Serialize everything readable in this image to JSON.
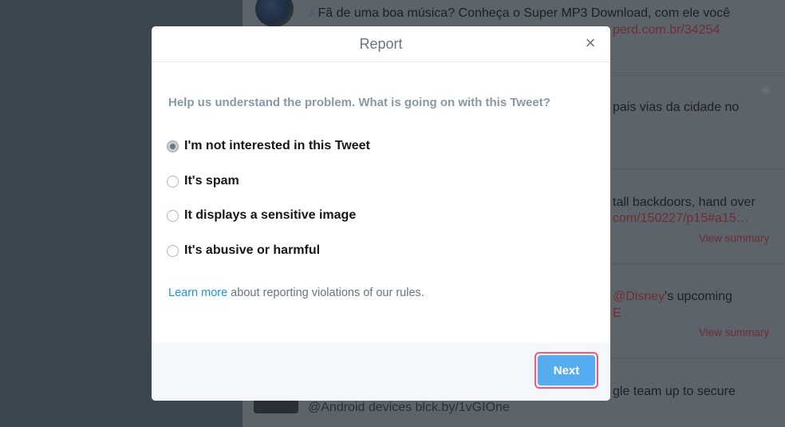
{
  "background_feed": {
    "tweet1_text": "Fã de uma boa música? Conheça o Super MP3 Download, com ele você",
    "tweet1_link": "perd.com.br/34254",
    "tweet2_text": "pais vias da cidade no",
    "tweet3_text": "tall backdoors, hand over",
    "tweet3_link": "com/150227/p15#a15…",
    "tweet3_summary": "View summary",
    "tweet4_link": "@Disney",
    "tweet4_text": "'s upcoming",
    "tweet4_link2": "E",
    "tweet4_summary": "View summary",
    "tweet5_text": "gle team up to secure",
    "tweet5_link": "@Android devices blck.by/1vGIOne"
  },
  "modal": {
    "title": "Report",
    "close_glyph": "×",
    "question": "Help us understand the problem. What is going on with this Tweet?",
    "options": [
      {
        "label": "I'm not interested in this Tweet",
        "checked": true
      },
      {
        "label": "It's spam",
        "checked": false
      },
      {
        "label": "It displays a sensitive image",
        "checked": false
      },
      {
        "label": "It's abusive or harmful",
        "checked": false
      }
    ],
    "learn_more_link": "Learn more",
    "learn_more_text": " about reporting violations of our rules.",
    "next_label": "Next"
  },
  "colors": {
    "accent": "#55acee",
    "link": "#1b95e0",
    "highlight_outline": "#e4607c"
  }
}
